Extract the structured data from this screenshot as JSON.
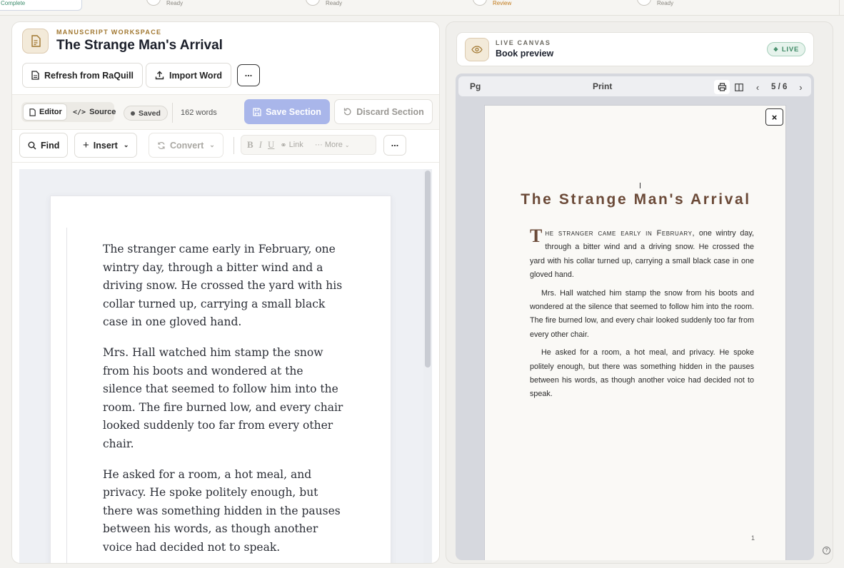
{
  "top_steps": {
    "first_status": "Complete",
    "items": [
      {
        "status": "Ready"
      },
      {
        "status": "Ready"
      },
      {
        "status": "Review"
      },
      {
        "status": "Ready"
      }
    ]
  },
  "workspace": {
    "eyebrow": "MANUSCRIPT WORKSPACE",
    "title": "The Strange Man's Arrival",
    "actions": {
      "refresh_label": "Refresh from RaQuill",
      "import_label": "Import Word",
      "more_label": "..."
    },
    "mode_tabs": {
      "editor": "Editor",
      "source": "Source"
    },
    "saved_label": "Saved",
    "word_count": "162 words",
    "save_section_label": "Save Section",
    "discard_section_label": "Discard Section",
    "toolbar": {
      "find": "Find",
      "insert": "Insert",
      "convert": "Convert",
      "bold": "B",
      "italic": "I",
      "underline": "U",
      "link": "Link",
      "more": "More",
      "overflow": "..."
    },
    "paragraphs": [
      "The stranger came early in February, one wintry day, through a bitter wind and a driving snow. He crossed the yard with his collar turned up, carrying a small black case in one gloved hand.",
      "Mrs. Hall watched him stamp the snow from his boots and wondered at the silence that seemed to follow him into the room. The fire burned low, and every chair looked suddenly too far from every other chair.",
      "He asked for a room, a hot meal, and privacy. He spoke politely enough, but there was something hidden in the pauses between his words, as though another voice had decided not to speak."
    ]
  },
  "canvas": {
    "eyebrow": "LIVE CANVAS",
    "title": "Book preview",
    "live_badge": "LIVE",
    "viewer": {
      "left_label": "Pg",
      "mode_label": "Print",
      "page_indicator": "5 / 6"
    },
    "preview": {
      "close_label": "×",
      "title": "The Strange Man's Arrival",
      "dropcap": "T",
      "smallcaps_lead": "he stranger came early in February,",
      "first_rest": " one wintry day, through a bitter wind and a driving snow. He crossed the yard with his collar turned up, carrying a small black case in one gloved hand.",
      "p2": "Mrs. Hall watched him stamp the snow from his boots and wondered at the silence that seemed to follow him into the room. The fire burned low, and every chair looked suddenly too far from every other chair.",
      "p3": "He asked for a room, a hot meal, and privacy. He spoke politely enough, but there was something hidden in the pauses between his words, as though another voice had decided not to speak.",
      "page_number": "1"
    }
  },
  "help_icon": "?",
  "colors": {
    "accent": "#a0762e",
    "primary_disabled": "#a9b6ea",
    "live_green": "#3f8a66",
    "title_brown": "#6b4a38"
  }
}
